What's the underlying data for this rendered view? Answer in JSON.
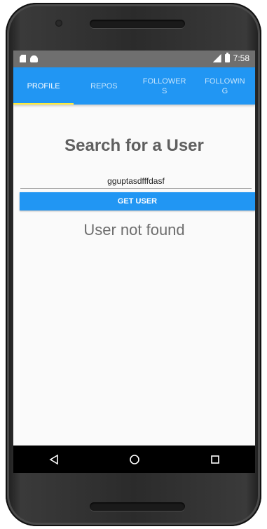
{
  "status_bar": {
    "time": "7:58",
    "icons": [
      "sd-card-icon",
      "android-icon",
      "signal-icon",
      "battery-icon"
    ]
  },
  "tabs": [
    {
      "label": "PROFILE",
      "active": true
    },
    {
      "label": "REPOS",
      "active": false
    },
    {
      "label": "FOLLOWERS",
      "active": false
    },
    {
      "label": "FOLLOWING",
      "active": false
    }
  ],
  "search": {
    "title": "Search for a User",
    "input_value": "gguptasdfffdasf",
    "button_label": "GET USER"
  },
  "result": {
    "message": "User not found"
  },
  "nav": {
    "icons": [
      "back-icon",
      "home-icon",
      "recents-icon"
    ]
  },
  "colors": {
    "primary": "#2196f3",
    "indicator": "#ffeb3b",
    "status_bar": "#6f6f6f",
    "text_muted": "#5f5f5f"
  }
}
